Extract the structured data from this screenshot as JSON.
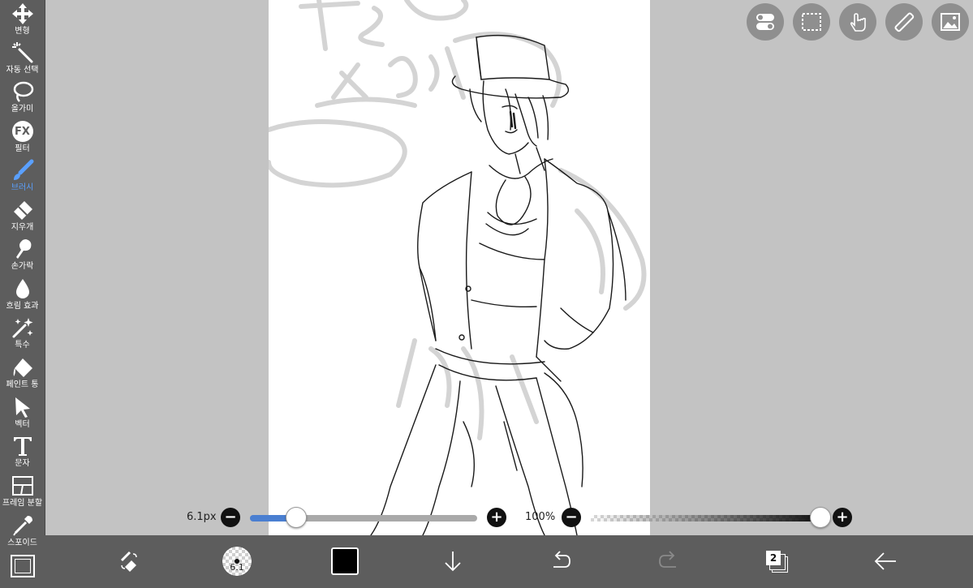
{
  "tools": [
    {
      "label": "변형",
      "icon": "move-arrows-icon",
      "active": false
    },
    {
      "label": "자동 선택",
      "icon": "magic-wand-icon",
      "active": false
    },
    {
      "label": "올가미",
      "icon": "lasso-icon",
      "active": false
    },
    {
      "label": "필터",
      "icon": "fx-icon",
      "active": false
    },
    {
      "label": "브러시",
      "icon": "brush-icon",
      "active": true
    },
    {
      "label": "지우개",
      "icon": "eraser-icon",
      "active": false
    },
    {
      "label": "손가락",
      "icon": "smudge-finger-icon",
      "active": false
    },
    {
      "label": "흐림 효과",
      "icon": "blur-drop-icon",
      "active": false
    },
    {
      "label": "특수",
      "icon": "special-sparkle-icon",
      "active": false
    },
    {
      "label": "페인트 통",
      "icon": "paint-bucket-icon",
      "active": false
    },
    {
      "label": "벡터",
      "icon": "vector-pointer-icon",
      "active": false
    },
    {
      "label": "문자",
      "icon": "text-t-icon",
      "active": false
    },
    {
      "label": "프레임 분할",
      "icon": "frame-divide-icon",
      "active": false
    },
    {
      "label": "스포이드",
      "icon": "eyedropper-icon",
      "active": false
    }
  ],
  "brush_size": {
    "value_text": "6.1px",
    "level": 0.2
  },
  "brush_opacity": {
    "value_text": "100%",
    "level": 1.0
  },
  "fx_text": "FX",
  "bottom": {
    "brush_preview_size": "6.1",
    "color": "#000000",
    "layer_count": "2"
  },
  "colors": {
    "accent": "#4a7fd1",
    "toolbar": "#5d5d5d",
    "workspace": "#c3c3c3"
  }
}
